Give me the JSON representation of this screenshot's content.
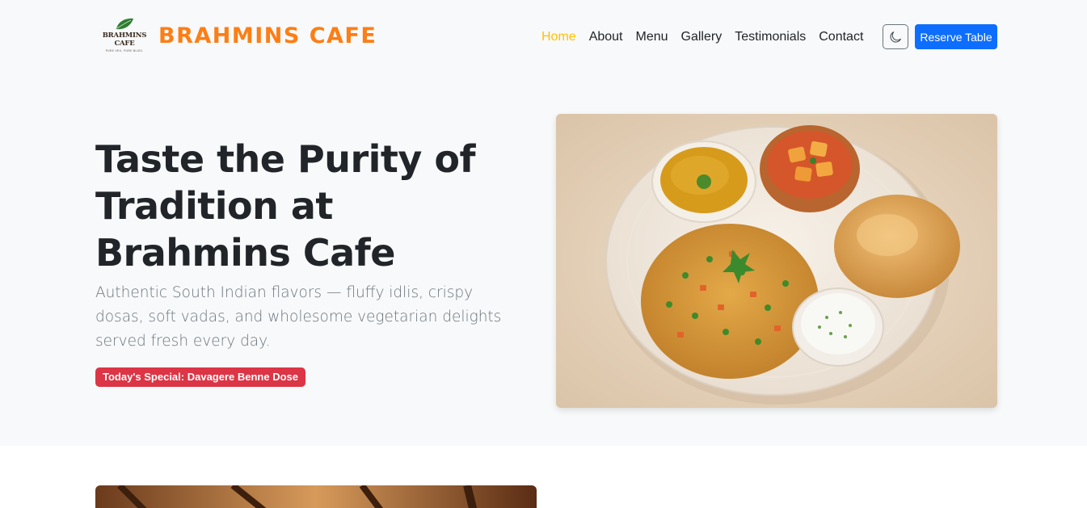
{
  "navbar": {
    "logo": {
      "name_line1": "BRAHMINS",
      "name_line2": "CAFE",
      "tagline": "PURE VEG. PURE BLISS."
    },
    "brand": "BRAHMINS CAFE",
    "links": [
      {
        "label": "Home",
        "active": true
      },
      {
        "label": "About",
        "active": false
      },
      {
        "label": "Menu",
        "active": false
      },
      {
        "label": "Gallery",
        "active": false
      },
      {
        "label": "Testimonials",
        "active": false
      },
      {
        "label": "Contact",
        "active": false
      }
    ],
    "theme_toggle_icon": "moon-icon",
    "reserve_label": "Reserve Table"
  },
  "hero": {
    "title": "Taste the Purity of Tradition at Brahmins Cafe",
    "lead": "Authentic South Indian flavors — fluffy idlis, crispy dosas, soft vadas, and wholesome vegetarian delights served fresh every day.",
    "special": "Today's Special: Davagere Benne Dose"
  },
  "colors": {
    "brand": "#fd7e14",
    "active_link": "#ffc107",
    "primary_button": "#0d6efd",
    "badge": "#dc3545",
    "muted_text": "#6c757d"
  }
}
